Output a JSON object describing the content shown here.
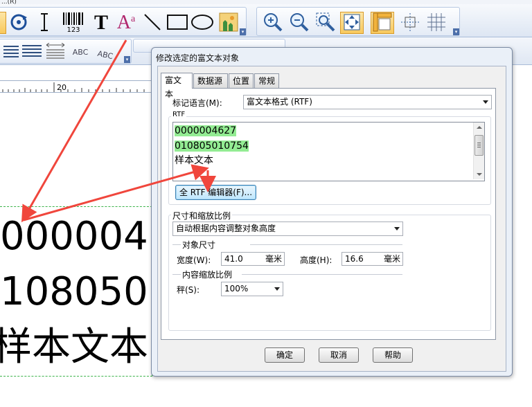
{
  "app": {
    "title_fragment": "...(R)",
    "ruler_label": "20",
    "canvas_lines": [
      "000004",
      "108050",
      "样本文本"
    ]
  },
  "toolbar": {
    "barcode_caption": "123",
    "text_glyph": "T",
    "richtext_glyph": "A",
    "richtext_superscript": "a",
    "format_abc_1": "ABC",
    "format_abc_2": "ABC"
  },
  "dialog": {
    "title": "修改选定的富文本对象",
    "tabs": [
      "富文本",
      "数据源",
      "位置",
      "常规"
    ],
    "active_tab": "富文本",
    "markup_label": "标记语言(M):",
    "markup_value": "富文本格式 (RTF)",
    "rtf_group_label": "RTF",
    "rtf_lines": [
      "0000004627",
      "010805010754",
      "样本文本"
    ],
    "full_editor_button": "全 RTF 编辑器(F)...",
    "size_group_label": "尺寸和缩放比例",
    "size_mode_value": "自动根据内容调整对象高度",
    "object_size_label": "对象尺寸",
    "width_label": "宽度(W):",
    "width_value": "41.0",
    "width_unit": "毫米",
    "height_label": "高度(H):",
    "height_value": "16.6",
    "height_unit": "毫米",
    "content_scale_label": "内容缩放比例",
    "scale_label": "秤(S):",
    "scale_value": "100%",
    "ok_button": "确定",
    "cancel_button": "取消",
    "help_button": "帮助"
  },
  "colors": {
    "highlight": "#93ec93",
    "annotation_arrow": "#f0463c",
    "selection_dash": "#3cb34a"
  }
}
